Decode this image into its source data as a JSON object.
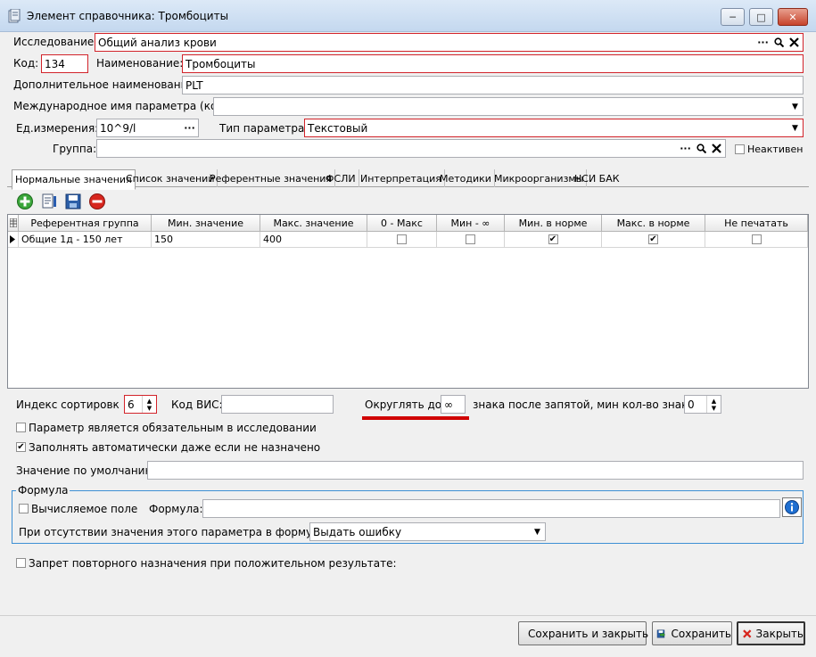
{
  "window": {
    "title": "Элемент справочника: Тромбоциты",
    "min_glyph": "─",
    "max_glyph": "□",
    "close_glyph": "✕"
  },
  "form": {
    "study_label": "Исследование:",
    "study_value": "Общий анализ крови",
    "code_label": "Код:",
    "code_value": "134",
    "name_label": "Наименование:",
    "name_value": "Тромбоциты",
    "extra_name_label": "Дополнительное наименование:",
    "extra_name_value": "PLT",
    "intl_name_label": "Международное имя параметра (код):",
    "intl_name_value": "",
    "unit_label": "Ед.измерения:",
    "unit_value": "10^9/l",
    "param_type_label": "Тип параметра:",
    "param_type_value": "Текстовый",
    "group_label": "Группа:",
    "group_value": "",
    "inactive_label": "Неактивен"
  },
  "tabs": [
    "Нормальные значения",
    "Список значений",
    "Референтные значения",
    "ФСЛИ",
    "Интерпретация",
    "Методики",
    "Микроорганизмы",
    "НСИ БАК"
  ],
  "table": {
    "headers": [
      "Референтная группа",
      "Мин. значение",
      "Макс. значение",
      "0 - Макс",
      "Мин - ∞",
      "Мин. в норме",
      "Макс. в норме",
      "Не печатать"
    ],
    "rows": [
      {
        "group": "Общие 1д - 150 лет",
        "min": "150",
        "max": "400",
        "zero_max": false,
        "min_inf": false,
        "min_norm": true,
        "max_norm": true,
        "no_print": false
      }
    ]
  },
  "bottom": {
    "sort_index_label": "Индекс сортировк",
    "sort_index_value": "6",
    "vis_code_label": "Код ВИС:",
    "vis_code_value": "",
    "round_label": "Округлять до",
    "round_value": "∞",
    "decimals_label": "знака после запятой, мин кол-во знаков",
    "decimals_value": "0",
    "mandatory_label": "Параметр является обязательным в исследовании",
    "mandatory_checked": false,
    "autofill_label": "Заполнять автоматически даже если не назначено",
    "autofill_checked": true,
    "default_label": "Значение по умолчанию:",
    "default_value": "",
    "formula_group_label": "Формула",
    "computed_label": "Вычисляемое поле",
    "computed_checked": false,
    "formula_label": "Формула:",
    "formula_value": "",
    "missing_label": "При отсутствии значения этого параметра в формуле:",
    "missing_value": "Выдать ошибку",
    "no_repeat_label": "Запрет повторного назначения при положительном результате:",
    "no_repeat_checked": false
  },
  "buttons": {
    "save_close": "Сохранить и закрыть",
    "save": "Сохранить",
    "close": "Закрыть"
  },
  "colors": {
    "required_border": "#d2232a",
    "underline": "#d00000"
  }
}
